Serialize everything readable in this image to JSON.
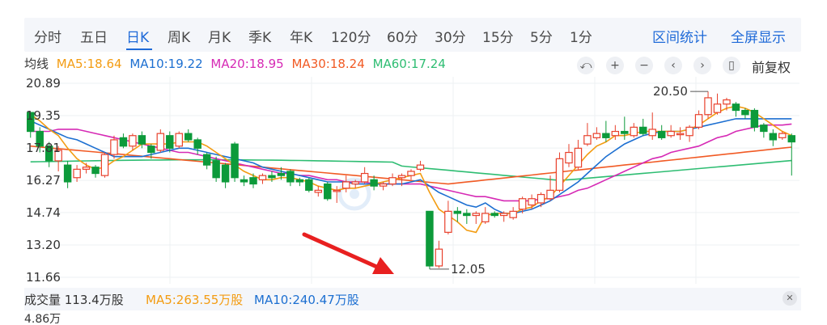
{
  "tabs": [
    {
      "label": "分时",
      "active": false
    },
    {
      "label": "五日",
      "active": false
    },
    {
      "label": "日K",
      "active": true
    },
    {
      "label": "周K",
      "active": false
    },
    {
      "label": "月K",
      "active": false
    },
    {
      "label": "季K",
      "active": false
    },
    {
      "label": "年K",
      "active": false
    },
    {
      "label": "120分",
      "active": false
    },
    {
      "label": "60分",
      "active": false
    },
    {
      "label": "30分",
      "active": false
    },
    {
      "label": "15分",
      "active": false
    },
    {
      "label": "5分",
      "active": false
    },
    {
      "label": "1分",
      "active": false
    }
  ],
  "links": {
    "stats": "区间统计",
    "fullscreen": "全屏显示"
  },
  "ma_header": {
    "label": "均线",
    "ma5": "MA5:18.64",
    "ma10": "MA10:19.22",
    "ma20": "MA20:18.95",
    "ma30": "MA30:18.24",
    "ma60": "MA60:17.24"
  },
  "controls": {
    "icons": [
      "undo-icon",
      "zoom-in-icon",
      "zoom-out-icon",
      "prev-icon",
      "next-icon",
      "candle-icon"
    ],
    "restore": "前复权"
  },
  "colors": {
    "up": "#e8412c",
    "down": "#0c9a3a",
    "ma5": "#f39c12",
    "ma10": "#1c6fd1",
    "ma20": "#d62ab5",
    "ma30": "#f15a24",
    "ma60": "#2ebd72",
    "arrow": "#e82020"
  },
  "volume": {
    "label": "成交量 113.4万股",
    "ma5": "MA5:263.55万股",
    "ma10": "MA10:240.47万股",
    "max_label": "4.86万"
  },
  "chart_data": {
    "type": "candlestick",
    "y_ticks": [
      "20.89",
      "19.35",
      "17.81",
      "16.27",
      "14.74",
      "13.20",
      "11.66"
    ],
    "ylim": [
      11.66,
      20.89
    ],
    "grid": true,
    "annotations": {
      "high": "20.50",
      "low": "12.05"
    },
    "candles": [
      [
        19.5,
        18.6,
        19.5,
        18.3
      ],
      [
        18.6,
        17.9,
        18.8,
        17.6
      ],
      [
        17.9,
        17.2,
        18.1,
        16.9
      ],
      [
        17.2,
        17.7,
        17.9,
        16.7
      ],
      [
        17.0,
        16.2,
        17.2,
        15.9
      ],
      [
        16.4,
        16.8,
        17.0,
        16.2
      ],
      [
        16.8,
        16.9,
        17.1,
        16.6
      ],
      [
        16.9,
        16.6,
        17.0,
        16.4
      ],
      [
        16.5,
        17.5,
        17.6,
        16.4
      ],
      [
        17.5,
        18.2,
        18.4,
        17.3
      ],
      [
        18.3,
        17.9,
        18.5,
        17.8
      ],
      [
        17.9,
        18.4,
        18.5,
        17.7
      ],
      [
        18.4,
        18.0,
        18.6,
        17.8
      ],
      [
        17.9,
        17.6,
        18.0,
        17.3
      ],
      [
        17.7,
        18.5,
        18.7,
        17.6
      ],
      [
        18.4,
        17.8,
        18.6,
        17.6
      ],
      [
        17.9,
        18.5,
        18.6,
        17.8
      ],
      [
        18.5,
        18.2,
        18.7,
        18.1
      ],
      [
        18.2,
        17.8,
        18.3,
        17.5
      ],
      [
        17.5,
        17.0,
        17.6,
        16.8
      ],
      [
        17.2,
        16.4,
        17.4,
        16.2
      ],
      [
        17.0,
        16.2,
        17.1,
        15.9
      ],
      [
        18.0,
        16.4,
        18.1,
        16.2
      ],
      [
        16.3,
        16.2,
        16.5,
        16.0
      ],
      [
        16.4,
        16.1,
        16.6,
        15.9
      ],
      [
        16.3,
        16.5,
        16.6,
        16.1
      ],
      [
        16.5,
        16.4,
        16.7,
        16.2
      ],
      [
        16.6,
        16.5,
        16.9,
        16.3
      ],
      [
        16.7,
        16.2,
        16.8,
        16.0
      ],
      [
        16.3,
        16.2,
        16.4,
        16.0
      ],
      [
        16.3,
        15.8,
        16.4,
        15.7
      ],
      [
        15.7,
        15.8,
        16.0,
        15.5
      ],
      [
        16.1,
        15.4,
        16.2,
        15.3
      ],
      [
        15.8,
        15.8,
        16.0,
        15.2
      ],
      [
        15.9,
        16.2,
        16.5,
        15.7
      ],
      [
        16.1,
        16.2,
        16.3,
        15.9
      ],
      [
        16.2,
        16.6,
        16.9,
        16.1
      ],
      [
        16.3,
        16.0,
        16.5,
        15.8
      ],
      [
        16.0,
        16.1,
        16.2,
        15.8
      ],
      [
        16.1,
        16.4,
        16.6,
        16.0
      ],
      [
        16.4,
        16.5,
        16.6,
        16.0
      ],
      [
        16.5,
        16.7,
        16.8,
        16.3
      ],
      [
        16.8,
        17.0,
        17.2,
        16.7
      ],
      [
        14.8,
        12.2,
        14.8,
        12.05
      ],
      [
        12.2,
        13.0,
        13.4,
        12.1
      ],
      [
        13.8,
        14.8,
        15.3,
        13.7
      ],
      [
        14.8,
        14.7,
        15.0,
        14.3
      ],
      [
        14.7,
        14.6,
        14.9,
        14.2
      ],
      [
        14.6,
        14.7,
        14.8,
        14.2
      ],
      [
        14.3,
        14.7,
        15.0,
        14.2
      ],
      [
        14.7,
        14.6,
        14.8,
        14.5
      ],
      [
        14.6,
        14.7,
        14.8,
        14.3
      ],
      [
        14.5,
        14.8,
        15.0,
        14.4
      ],
      [
        14.9,
        15.4,
        15.5,
        14.7
      ],
      [
        15.1,
        15.4,
        15.6,
        14.9
      ],
      [
        15.2,
        15.6,
        15.7,
        15.0
      ],
      [
        15.4,
        15.8,
        16.5,
        15.3
      ],
      [
        15.8,
        17.3,
        17.6,
        15.7
      ],
      [
        17.1,
        17.6,
        18.0,
        16.9
      ],
      [
        16.9,
        17.8,
        18.2,
        16.8
      ],
      [
        18.0,
        18.4,
        19.0,
        17.9
      ],
      [
        18.3,
        18.5,
        18.8,
        18.2
      ],
      [
        18.5,
        18.3,
        19.1,
        18.1
      ],
      [
        18.4,
        18.6,
        18.9,
        18.2
      ],
      [
        18.6,
        18.5,
        19.3,
        18.2
      ],
      [
        18.4,
        18.8,
        19.0,
        18.3
      ],
      [
        18.8,
        18.5,
        19.2,
        18.4
      ],
      [
        18.4,
        18.7,
        19.5,
        18.2
      ],
      [
        18.6,
        18.3,
        18.9,
        18.2
      ],
      [
        18.4,
        18.6,
        18.9,
        18.3
      ],
      [
        18.5,
        18.5,
        18.8,
        18.2
      ],
      [
        18.4,
        18.8,
        18.9,
        18.1
      ],
      [
        18.8,
        19.4,
        19.6,
        18.7
      ],
      [
        19.4,
        20.2,
        20.5,
        19.2
      ],
      [
        19.5,
        19.9,
        20.4,
        19.4
      ],
      [
        19.9,
        20.1,
        20.2,
        19.6
      ],
      [
        19.9,
        19.6,
        20.0,
        19.3
      ],
      [
        19.6,
        19.4,
        19.7,
        19.2
      ],
      [
        19.6,
        18.8,
        19.7,
        18.6
      ],
      [
        18.9,
        18.6,
        19.0,
        18.3
      ],
      [
        18.5,
        18.2,
        18.7,
        17.9
      ],
      [
        18.3,
        18.5,
        18.6,
        18.2
      ],
      [
        18.4,
        18.1,
        18.5,
        16.5
      ]
    ],
    "ma5": [
      19.4,
      19.1,
      18.7,
      18.4,
      17.8,
      17.3,
      17.0,
      16.8,
      16.9,
      17.2,
      17.4,
      17.7,
      18.0,
      18.0,
      18.0,
      18.0,
      18.1,
      18.1,
      18.1,
      17.9,
      17.6,
      17.3,
      17.0,
      16.7,
      16.5,
      16.3,
      16.3,
      16.4,
      16.4,
      16.3,
      16.2,
      16.0,
      15.9,
      15.8,
      15.9,
      15.9,
      16.0,
      16.1,
      16.2,
      16.3,
      16.4,
      16.5,
      16.6,
      15.7,
      14.9,
      14.6,
      14.3,
      13.9,
      13.8,
      14.6,
      14.7,
      14.7,
      14.7,
      14.9,
      15.0,
      15.3,
      15.5,
      16.0,
      16.5,
      17.0,
      17.5,
      17.9,
      18.1,
      18.4,
      18.4,
      18.5,
      18.6,
      18.6,
      18.6,
      18.6,
      18.6,
      18.7,
      18.9,
      19.2,
      19.5,
      19.7,
      19.8,
      19.7,
      19.5,
      19.2,
      18.9,
      18.6,
      18.4
    ],
    "ma10": [
      19.1,
      18.9,
      18.7,
      18.5,
      18.3,
      18.2,
      18.0,
      17.8,
      17.6,
      17.4,
      17.4,
      17.4,
      17.4,
      17.5,
      17.6,
      17.7,
      17.8,
      17.8,
      17.7,
      17.6,
      17.5,
      17.4,
      17.3,
      17.2,
      17.1,
      16.9,
      16.8,
      16.7,
      16.6,
      16.5,
      16.4,
      16.3,
      16.2,
      16.2,
      16.2,
      16.1,
      16.1,
      16.1,
      16.1,
      16.1,
      16.1,
      16.2,
      16.3,
      16.0,
      15.7,
      15.5,
      15.3,
      15.1,
      15.0,
      15.2,
      14.9,
      14.7,
      14.7,
      14.8,
      14.9,
      15.1,
      15.3,
      15.6,
      15.9,
      16.2,
      16.6,
      17.0,
      17.4,
      17.7,
      18.0,
      18.2,
      18.4,
      18.5,
      18.6,
      18.6,
      18.6,
      18.7,
      18.8,
      18.9,
      19.0,
      19.1,
      19.2,
      19.2,
      19.2,
      19.2,
      19.2,
      19.2,
      19.2
    ],
    "ma20": [
      18.6,
      18.6,
      18.6,
      18.7,
      18.7,
      18.7,
      18.6,
      18.5,
      18.4,
      18.3,
      18.2,
      18.1,
      18.0,
      17.9,
      17.8,
      17.7,
      17.6,
      17.6,
      17.5,
      17.4,
      17.3,
      17.2,
      17.1,
      17.0,
      16.9,
      16.8,
      16.7,
      16.6,
      16.6,
      16.5,
      16.5,
      16.4,
      16.3,
      16.3,
      16.2,
      16.2,
      16.2,
      16.1,
      16.1,
      16.1,
      16.1,
      16.1,
      16.1,
      16.0,
      15.9,
      15.8,
      15.7,
      15.6,
      15.5,
      15.5,
      15.4,
      15.3,
      15.3,
      15.3,
      15.3,
      15.4,
      15.4,
      15.5,
      15.6,
      15.8,
      15.9,
      16.1,
      16.3,
      16.5,
      16.7,
      16.9,
      17.1,
      17.3,
      17.4,
      17.6,
      17.7,
      17.8,
      17.9,
      18.1,
      18.3,
      18.4,
      18.6,
      18.7,
      18.8,
      18.9,
      18.9,
      18.9,
      18.95
    ]
  }
}
